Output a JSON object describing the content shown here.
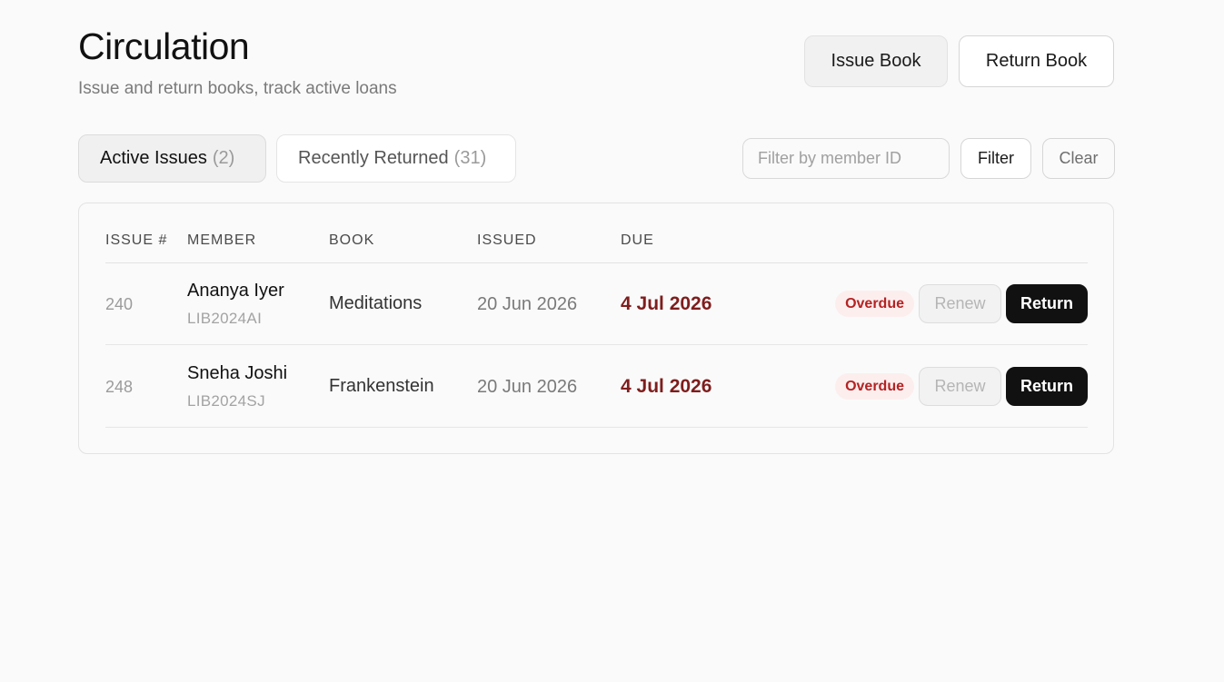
{
  "header": {
    "title": "Circulation",
    "subtitle": "Issue and return books, track active loans",
    "issue_book_label": "Issue Book",
    "return_book_label": "Return Book"
  },
  "tabs": [
    {
      "label": "Active Issues",
      "count": "(2)",
      "active": true
    },
    {
      "label": "Recently Returned",
      "count": "(31)",
      "active": false
    }
  ],
  "filter": {
    "placeholder": "Filter by member ID",
    "value": "",
    "filter_label": "Filter",
    "clear_label": "Clear"
  },
  "table": {
    "columns": [
      "ISSUE #",
      "MEMBER",
      "BOOK",
      "ISSUED",
      "DUE"
    ],
    "rows": [
      {
        "issue_no": "240",
        "member_name": "Ananya Iyer",
        "member_id": "LIB2024AI",
        "book": "Meditations",
        "issued": "20 Jun 2026",
        "due": "4 Jul 2026",
        "status": "Overdue",
        "renew_label": "Renew",
        "return_label": "Return"
      },
      {
        "issue_no": "248",
        "member_name": "Sneha Joshi",
        "member_id": "LIB2024SJ",
        "book": "Frankenstein",
        "issued": "20 Jun 2026",
        "due": "4 Jul 2026",
        "status": "Overdue",
        "renew_label": "Renew",
        "return_label": "Return"
      }
    ]
  },
  "colors": {
    "background": "#fafafa",
    "overdue_text": "#b42323",
    "overdue_bg": "#fdeeee",
    "due_text": "#7f1d1d",
    "primary_button": "#111111"
  }
}
